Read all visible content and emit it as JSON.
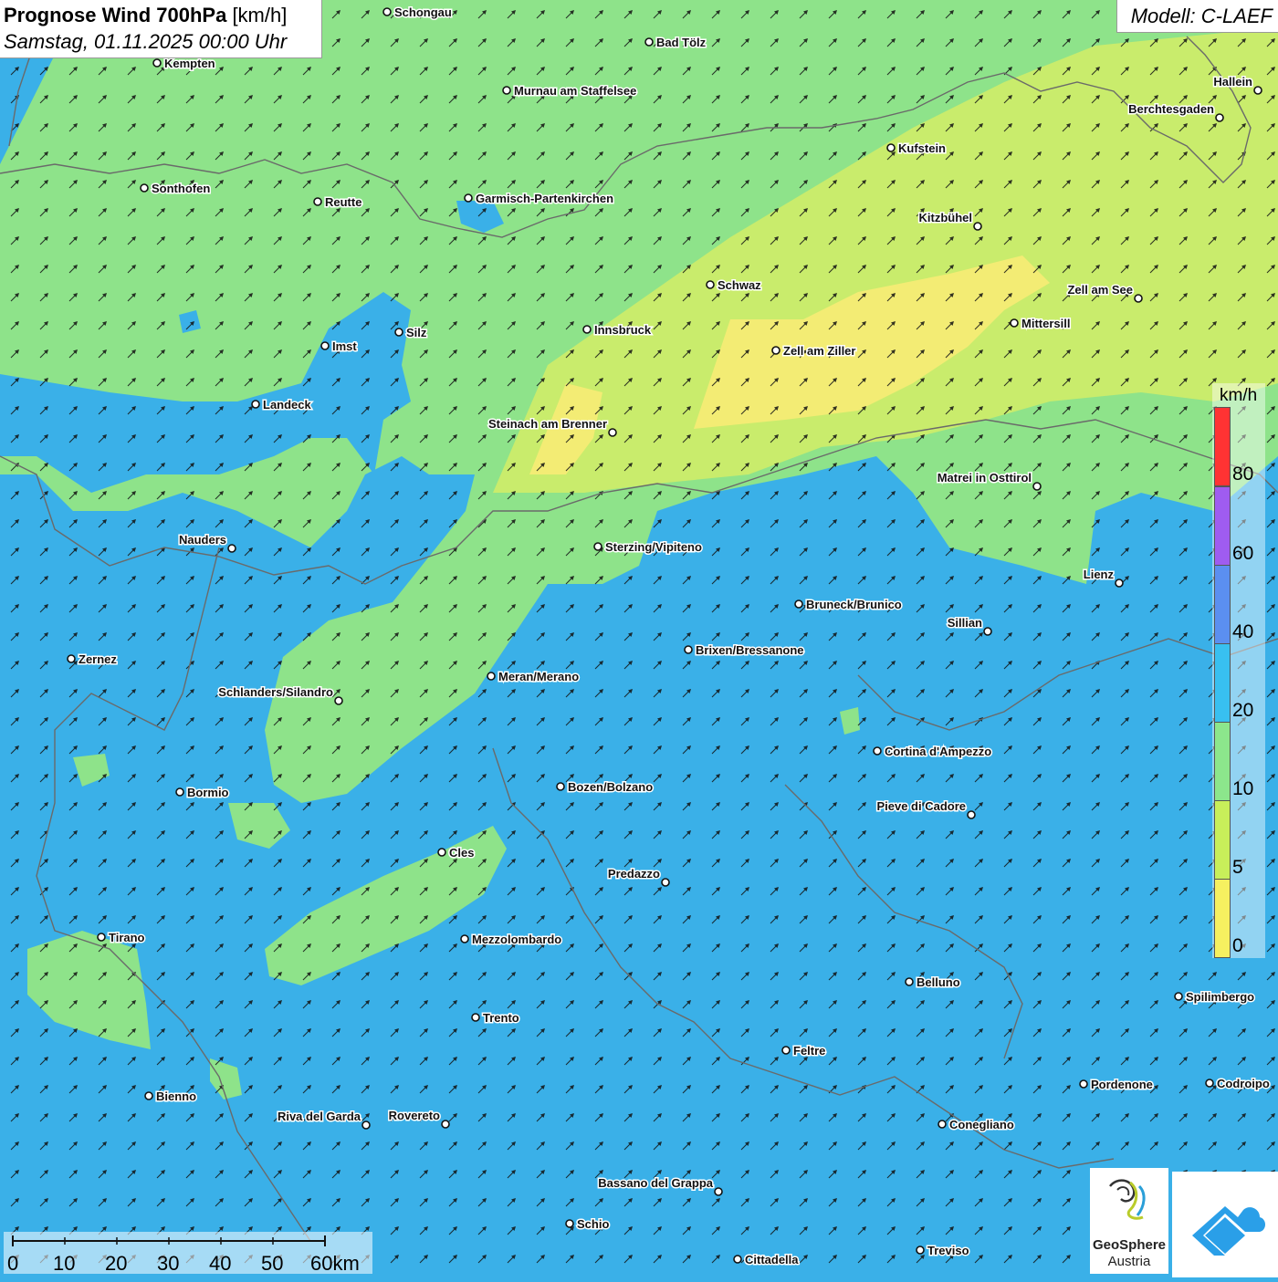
{
  "header": {
    "title_bold": "Prognose Wind 700hPa",
    "title_unit": "[km/h]",
    "datetime": "Samstag, 01.11.2025 00:00 Uhr",
    "model": "Modell: C-LAEF"
  },
  "legend": {
    "unit": "km/h",
    "labels": [
      "80",
      "60",
      "40",
      "20",
      "10",
      "5",
      "0"
    ],
    "colors": [
      "#ff3333",
      "#9f5cf0",
      "#5b8ff0",
      "#38c0f0",
      "#8ce68c",
      "#c8ef5a",
      "#f6f060"
    ]
  },
  "scalebar": {
    "labels": [
      "0",
      "10",
      "20",
      "30",
      "40",
      "50",
      "60km"
    ]
  },
  "logos": {
    "geosphere_name": "GeoSphere",
    "geosphere_sub": "Austria"
  },
  "palette": {
    "zone_blue": "#3ab0e8",
    "zone_green": "#8ee38a",
    "zone_lime": "#c9ec6c",
    "zone_yellow": "#f3ec74",
    "border": "#6a6a6a"
  },
  "cities": [
    {
      "name": "Schongau",
      "anchor": "start"
    },
    {
      "name": "Bad Tölz",
      "anchor": "start"
    },
    {
      "name": "Kempten",
      "anchor": "start"
    },
    {
      "name": "Murnau am Staffelsee",
      "anchor": "start"
    },
    {
      "name": "Hallein",
      "anchor": "end"
    },
    {
      "name": "Berchtesgaden",
      "anchor": "end"
    },
    {
      "name": "Kufstein",
      "anchor": "start"
    },
    {
      "name": "Sonthofen",
      "anchor": "start"
    },
    {
      "name": "Reutte",
      "anchor": "start"
    },
    {
      "name": "Garmisch-Partenkirchen",
      "anchor": "start"
    },
    {
      "name": "Kitzbühel",
      "anchor": "end"
    },
    {
      "name": "Schwaz",
      "anchor": "start"
    },
    {
      "name": "Zell am See",
      "anchor": "end"
    },
    {
      "name": "Mittersill",
      "anchor": "start"
    },
    {
      "name": "Innsbruck",
      "anchor": "start"
    },
    {
      "name": "Silz",
      "anchor": "start"
    },
    {
      "name": "Imst",
      "anchor": "start"
    },
    {
      "name": "Zell am Ziller",
      "anchor": "start"
    },
    {
      "name": "Landeck",
      "anchor": "start"
    },
    {
      "name": "Steinach am Brenner",
      "anchor": "end"
    },
    {
      "name": "Matrei in Osttirol",
      "anchor": "end"
    },
    {
      "name": "Nauders",
      "anchor": "end"
    },
    {
      "name": "Sterzing/Vipiteno",
      "anchor": "start"
    },
    {
      "name": "Lienz",
      "anchor": "end"
    },
    {
      "name": "Bruneck/Brunico",
      "anchor": "start"
    },
    {
      "name": "Sillian",
      "anchor": "end"
    },
    {
      "name": "Brixen/Bressanone",
      "anchor": "start"
    },
    {
      "name": "Zernez",
      "anchor": "start"
    },
    {
      "name": "Meran/Merano",
      "anchor": "start"
    },
    {
      "name": "Schlanders/Silandro",
      "anchor": "end"
    },
    {
      "name": "Cortina d'Ampezzo",
      "anchor": "start"
    },
    {
      "name": "Bozen/Bolzano",
      "anchor": "start"
    },
    {
      "name": "Bormio",
      "anchor": "start"
    },
    {
      "name": "Pieve di Cadore",
      "anchor": "end"
    },
    {
      "name": "Cles",
      "anchor": "start"
    },
    {
      "name": "Predazzo",
      "anchor": "end"
    },
    {
      "name": "Tirano",
      "anchor": "start"
    },
    {
      "name": "Mezzolombardo",
      "anchor": "start"
    },
    {
      "name": "Belluno",
      "anchor": "start"
    },
    {
      "name": "Spilimbergo",
      "anchor": "start"
    },
    {
      "name": "Trento",
      "anchor": "start"
    },
    {
      "name": "Feltre",
      "anchor": "start"
    },
    {
      "name": "Pordenone",
      "anchor": "start"
    },
    {
      "name": "Codroipo",
      "anchor": "start"
    },
    {
      "name": "Bienno",
      "anchor": "start"
    },
    {
      "name": "Riva del Garda",
      "anchor": "end"
    },
    {
      "name": "Rovereto",
      "anchor": "end"
    },
    {
      "name": "Conegliano",
      "anchor": "start"
    },
    {
      "name": "Bassano del Grappa",
      "anchor": "end"
    },
    {
      "name": "Schio",
      "anchor": "start"
    },
    {
      "name": "Treviso",
      "anchor": "start"
    },
    {
      "name": "Cittadella",
      "anchor": "start"
    }
  ]
}
